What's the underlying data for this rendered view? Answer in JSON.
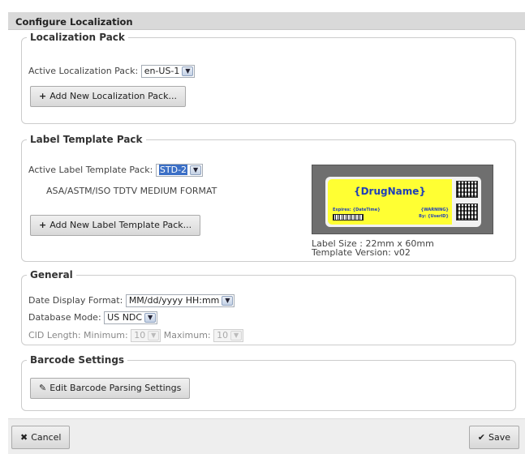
{
  "dialog": {
    "title": "Configure Localization"
  },
  "localization_pack": {
    "legend": "Localization Pack",
    "active_label": "Active Localization Pack:",
    "active_value": "en-US-1",
    "add_button": "Add New Localization Pack..."
  },
  "label_template_pack": {
    "legend": "Label Template Pack",
    "active_label": "Active Label Template Pack:",
    "active_value": "STD-2",
    "format_name": "ASA/ASTM/ISO TDTV MEDIUM FORMAT",
    "add_button": "Add New Label Template Pack...",
    "preview": {
      "drug_name": "{DrugName}",
      "expires": "Expires: {DateTime}",
      "warning": "{WARNING}",
      "by": "By: {UserID}"
    },
    "label_size": "Label Size :  22mm x 60mm",
    "template_version": "Template Version:  v02"
  },
  "general": {
    "legend": "General",
    "date_format_label": "Date Display Format:",
    "date_format_value": "MM/dd/yyyy HH:mm",
    "db_mode_label": "Database Mode:",
    "db_mode_value": "US NDC",
    "cid_label": "CID Length: Minimum:",
    "cid_min": "10",
    "cid_max_label": "Maximum:",
    "cid_max": "10"
  },
  "barcode": {
    "legend": "Barcode Settings",
    "edit_button": "Edit Barcode Parsing Settings"
  },
  "footer": {
    "cancel": "Cancel",
    "save": "Save"
  },
  "colors": {
    "highlight": "#3b6fc6",
    "label_yellow": "#ffff33",
    "label_text": "#1f3fb8"
  },
  "icons": [
    "plus-icon",
    "pencil-icon",
    "x-icon",
    "checkmark-icon",
    "chevron-down-icon"
  ]
}
